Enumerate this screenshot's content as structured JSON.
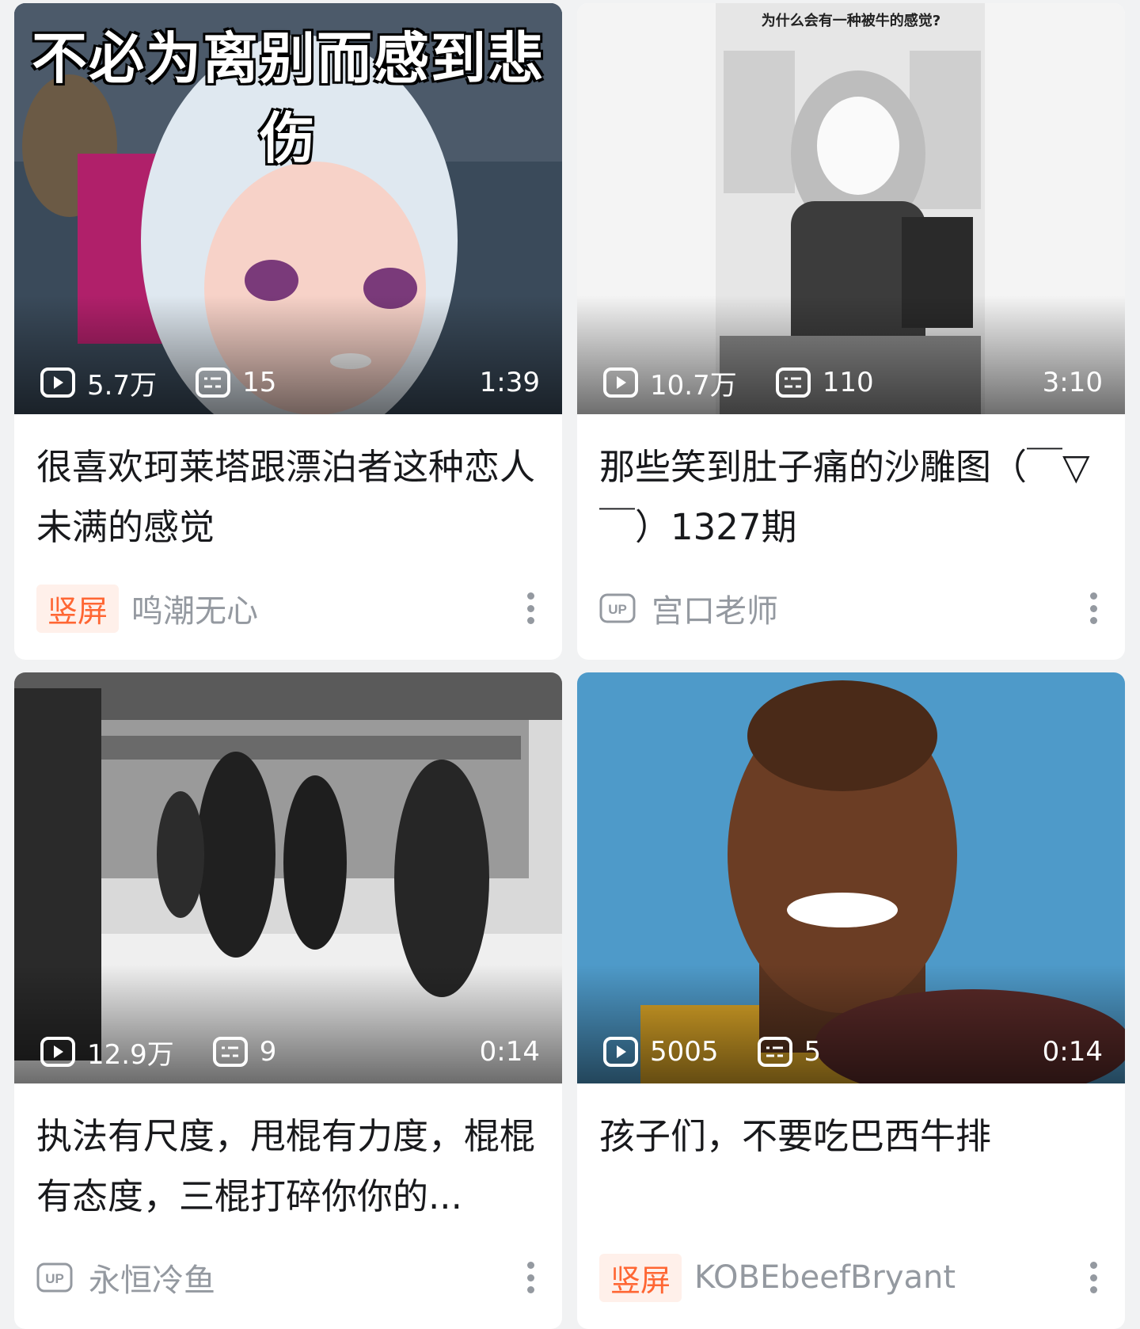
{
  "cards": [
    {
      "thumb_overlay_text": "不必为离别而感到悲伤",
      "views": "5.7万",
      "danmaku": "15",
      "duration": "1:39",
      "title": "很喜欢珂莱塔跟漂泊者这种恋人未满的感觉",
      "badge": "竖屏",
      "author": "鸣潮无心",
      "author_icon": "vertical-badge"
    },
    {
      "thumb_overlay_text": "为什么会有一种被牛的感觉?",
      "views": "10.7万",
      "danmaku": "110",
      "duration": "3:10",
      "title": "那些笑到肚子痛的沙雕图（￣▽￣）1327期",
      "badge": "",
      "author": "宫口老师",
      "author_icon": "up-icon"
    },
    {
      "views": "12.9万",
      "danmaku": "9",
      "duration": "0:14",
      "title": "执法有尺度，甩棍有力度，棍棍有态度，三棍打碎你你的...",
      "badge": "",
      "author": "永恒冷鱼",
      "author_icon": "up-icon"
    },
    {
      "views": "5005",
      "danmaku": "5",
      "duration": "0:14",
      "title": "孩子们，不要吃巴西牛排",
      "badge": "竖屏",
      "author": "KOBEbeefBryant",
      "author_icon": "vertical-badge"
    }
  ],
  "colors": {
    "background": "#f1f2f3",
    "badge_text": "#ff6633",
    "badge_bg": "#fff0ea",
    "meta": "#9499a0",
    "title": "#18191c"
  }
}
